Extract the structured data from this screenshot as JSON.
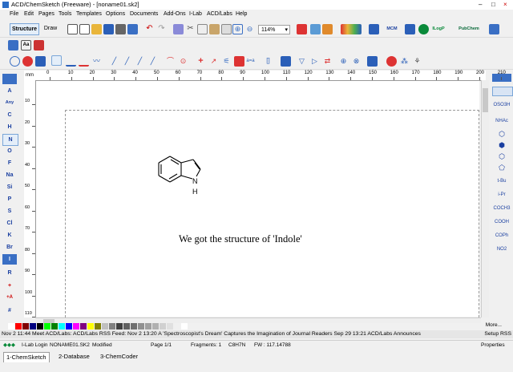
{
  "window": {
    "title": "ACD/ChemSketch (Freeware) - [noname01.sk2]",
    "controls": [
      "–",
      "□",
      "×"
    ]
  },
  "menu": [
    "File",
    "Edit",
    "Pages",
    "Tools",
    "Templates",
    "Options",
    "Documents",
    "Add-Ons",
    "I-Lab",
    "ACD/Labs",
    "Help"
  ],
  "toolbar": {
    "structure_label": "Structure",
    "draw_label": "Draw",
    "zoom_value": "114%",
    "mcm_label": "MCM",
    "ilogp_label": "ILogP",
    "pubchem_label": "PubChem"
  },
  "left_elements": [
    "A",
    "Any",
    "C",
    "H",
    "N",
    "O",
    "F",
    "Na",
    "Si",
    "P",
    "S",
    "Cl",
    "K",
    "Br",
    "I",
    "R",
    "+",
    "+A",
    "#"
  ],
  "right_groups": [
    "OSO3H",
    "NHAc",
    "t-Bu",
    "i-Pr",
    "COCH3",
    "COOH",
    "COPh",
    "NO2"
  ],
  "ruler": {
    "unit": "mm",
    "h_ticks": [
      "0",
      "10",
      "20",
      "30",
      "40",
      "50",
      "60",
      "70",
      "80",
      "90",
      "100",
      "110",
      "120",
      "130",
      "140",
      "150",
      "160",
      "170",
      "180",
      "190",
      "200",
      "210"
    ],
    "v_ticks": [
      "10",
      "20",
      "30",
      "40",
      "50",
      "60",
      "70",
      "80",
      "90",
      "100",
      "110"
    ]
  },
  "structure": {
    "atom_label": "N",
    "h_label": "H"
  },
  "caption": "We got the structure of 'Indole'",
  "palette_colors": [
    "#ffffff",
    "#ff0000",
    "#800000",
    "#000080",
    "#000000",
    "#00ff00",
    "#008000",
    "#00ffff",
    "#0000ff",
    "#ff00ff",
    "#800080",
    "#ffff00",
    "#808000",
    "#c0c0c0",
    "#808080",
    "#404040",
    "#606060",
    "#707070",
    "#909090",
    "#a0a0a0",
    "#b0b0b0",
    "#d0d0d0",
    "#e0e0e0",
    "#f0f0f0",
    "#ffffff"
  ],
  "news_ticker": "Nov 2 11:44 Meet ACD/Labs: ACD/Labs RSS Feed: Nov 2 13:20 A 'Spectroscopist's Dream' Captures the Imagination of Journal Readers  Sep 29 13:21 ACD/Labs Announces",
  "news_more": "More...",
  "setup_rss": "Setup RSS",
  "status": {
    "login": "I-Lab Login",
    "file": "NONAME01.SK2",
    "modified": "Modified",
    "page": "Page 1/1",
    "fragments": "Fragments: 1",
    "formula": "C8H7N",
    "fw": "FW : 117.14788",
    "properties": "Properties"
  },
  "tabs": [
    "1-ChemSketch",
    "2-Database",
    "3-ChemCoder"
  ]
}
